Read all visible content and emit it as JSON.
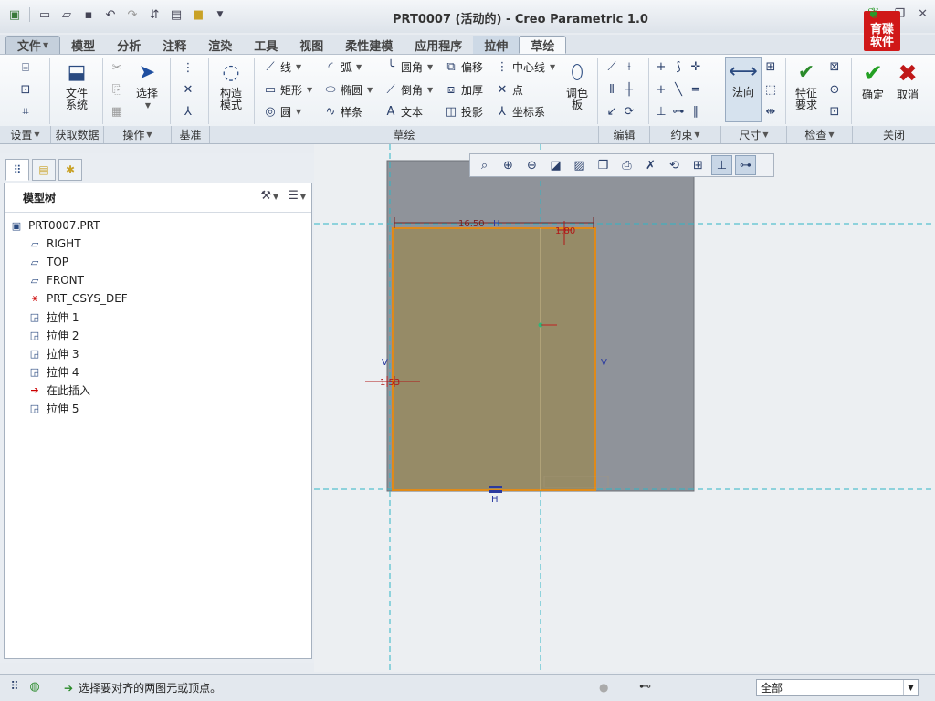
{
  "window": {
    "title": "PRT0007 (活动的) - Creo Parametric 1.0",
    "brand_top": "育碟",
    "brand_bottom": "软件"
  },
  "tabs": [
    "文件",
    "模型",
    "分析",
    "注释",
    "渲染",
    "工具",
    "视图",
    "柔性建模",
    "应用程序",
    "拉伸",
    "草绘"
  ],
  "ribbon": {
    "groups": [
      "设置",
      "获取数据",
      "操作",
      "基准",
      "草绘",
      "编辑",
      "约束",
      "尺寸",
      "检查",
      "关闭"
    ],
    "file_system": "文件\n系统",
    "select": "选择",
    "construction_mode": "构造\n模式",
    "sketch_tools": {
      "line": "线",
      "arc": "弧",
      "fillet": "圆角",
      "offset": "偏移",
      "centerline": "中心线",
      "rectangle": "矩形",
      "ellipse": "椭圆",
      "chamfer": "倒角",
      "thicken": "加厚",
      "point": "点",
      "circle": "圆",
      "spline": "样条",
      "text": "文本",
      "project": "投影",
      "csys": "坐标系"
    },
    "palette": "调色\n板",
    "normal": "法向",
    "feature_req": "特征\n要求",
    "ok": "确定",
    "cancel": "取消"
  },
  "model_tree": {
    "title": "模型树",
    "items": [
      {
        "label": "PRT0007.PRT",
        "icon": "part-icon"
      },
      {
        "label": "RIGHT",
        "icon": "datum-plane-icon"
      },
      {
        "label": "TOP",
        "icon": "datum-plane-icon"
      },
      {
        "label": "FRONT",
        "icon": "datum-plane-icon"
      },
      {
        "label": "PRT_CSYS_DEF",
        "icon": "csys-icon"
      },
      {
        "label": "拉伸 1",
        "icon": "extrude-icon"
      },
      {
        "label": "拉伸 2",
        "icon": "extrude-icon"
      },
      {
        "label": "拉伸 3",
        "icon": "extrude-icon"
      },
      {
        "label": "拉伸 4",
        "icon": "extrude-icon"
      },
      {
        "label": "在此插入",
        "icon": "insert-here-icon"
      },
      {
        "label": "拉伸 5",
        "icon": "extrude-new-icon"
      }
    ]
  },
  "sketch": {
    "dim_width": "16.50",
    "dim_top": "1.80",
    "dim_left": "1.53",
    "label_h_top": "H",
    "label_h_bottom": "H",
    "label_v_left": "V",
    "label_v_right": "V"
  },
  "status": {
    "message": "选择要对齐的两图元或顶点。",
    "filter": "全部"
  }
}
